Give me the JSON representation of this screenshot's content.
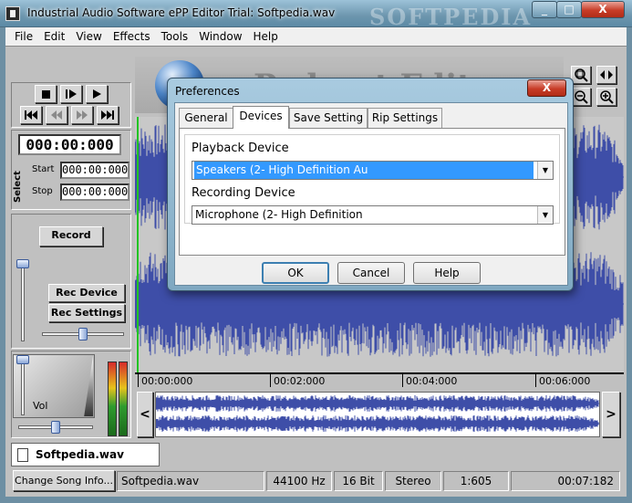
{
  "window": {
    "title": "Industrial Audio Software ePP Editor Trial: Softpedia.wav",
    "watermark": "SOFTPEDIA",
    "minimize": "_",
    "maximize": "□",
    "close": "X"
  },
  "menu": [
    "File",
    "Edit",
    "View",
    "Effects",
    "Tools",
    "Window",
    "Help"
  ],
  "header_banner": "Podcast Editor",
  "transport": {
    "time": "000:00:000",
    "select_label": "Select",
    "start_label": "Start",
    "start_value": "000:00:000",
    "stop_label": "Stop",
    "stop_value": "000:00:000"
  },
  "record": {
    "record_button": "Record",
    "rec_device_button": "Rec Device",
    "rec_settings_button": "Rec Settings",
    "vol_label": "Vol"
  },
  "ruler": [
    "00:00:000",
    "00:02:000",
    "00:04:000",
    "00:06:000"
  ],
  "overview": {
    "left_arrow": "<",
    "right_arrow": ">"
  },
  "file_tab": "Softpedia.wav",
  "status": {
    "change_song_button": "Change Song Info...",
    "file": "Softpedia.wav",
    "rate": "44100 Hz",
    "bits": "16 Bit",
    "channels": "Stereo",
    "ratio": "1:605",
    "duration": "00:07:182"
  },
  "dialog": {
    "title": "Preferences",
    "close": "X",
    "tabs": [
      "General",
      "Devices",
      "Save Setting",
      "Rip Settings"
    ],
    "active_tab": "Devices",
    "playback_label": "Playback Device",
    "playback_value": "Speakers (2- High Definition Au",
    "recording_label": "Recording Device",
    "recording_value": "Microphone (2- High Definition",
    "ok_button": "OK",
    "cancel_button": "Cancel",
    "help_button": "Help"
  }
}
